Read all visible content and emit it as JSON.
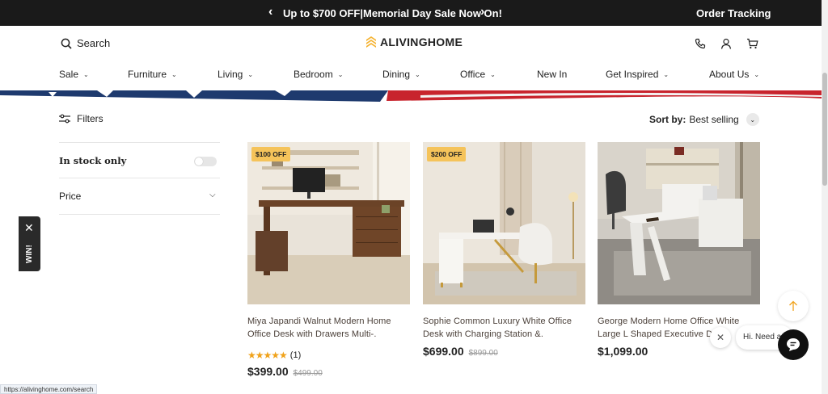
{
  "announcement": {
    "message": "Up to $700 OFF|Memorial Day Sale Now On!",
    "prev_icon": "chevron-left-icon",
    "next_icon": "chevron-right-icon",
    "order_tracking": "Order Tracking"
  },
  "header": {
    "search_label": "Search",
    "logo_text": "ALIVINGHOME",
    "brand_color": "#f5b332",
    "icons": [
      "phone-icon",
      "account-icon",
      "cart-icon"
    ]
  },
  "nav": {
    "items": [
      {
        "label": "Sale",
        "has_dropdown": true
      },
      {
        "label": "Furniture",
        "has_dropdown": true
      },
      {
        "label": "Living",
        "has_dropdown": true
      },
      {
        "label": "Bedroom",
        "has_dropdown": true
      },
      {
        "label": "Dining",
        "has_dropdown": true
      },
      {
        "label": "Office",
        "has_dropdown": true
      },
      {
        "label": "New In",
        "has_dropdown": false
      },
      {
        "label": "Get Inspired",
        "has_dropdown": true
      },
      {
        "label": "About Us",
        "has_dropdown": true
      }
    ]
  },
  "toolbar": {
    "filters_label": "Filters",
    "sort_label": "Sort by:",
    "sort_value": "Best selling"
  },
  "facets": {
    "in_stock_label": "In stock only",
    "in_stock_on": false,
    "price_label": "Price"
  },
  "side_tab": {
    "label": "WIN!"
  },
  "products": [
    {
      "badge": "$100 OFF",
      "title": "Miya Japandi Walnut Modern Home Office Desk with Drawers Multi-.",
      "stars": "★★★★★",
      "review_count": "(1)",
      "price": "$399.00",
      "was": "$499.00"
    },
    {
      "badge": "$200 OFF",
      "title": "Sophie Common Luxury White Office Desk with Charging Station &.",
      "stars": "",
      "review_count": "",
      "price": "$699.00",
      "was": "$899.00"
    },
    {
      "badge": "",
      "title": "George Modern Home Office White Large L Shaped Executive Desk",
      "stars": "",
      "review_count": "",
      "price": "$1,099.00",
      "was": ""
    }
  ],
  "chat": {
    "greeting": "Hi. Need any help?"
  },
  "status_bar": {
    "url": "https://alivinghome.com/search"
  }
}
